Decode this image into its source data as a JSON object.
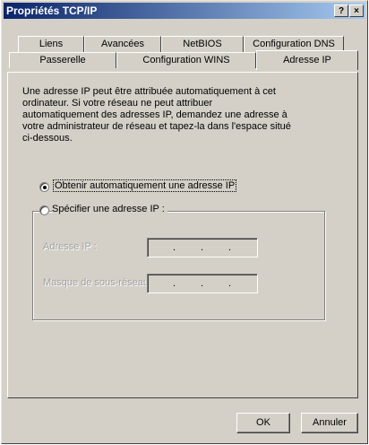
{
  "window": {
    "title": "Propriétés TCP/IP",
    "help_button": "?",
    "close_button": "×"
  },
  "tabs": {
    "row1": [
      "Liens",
      "Avancées",
      "NetBIOS",
      "Configuration DNS"
    ],
    "row2": [
      "Passerelle",
      "Configuration WINS",
      "Adresse IP"
    ],
    "active": "Adresse IP"
  },
  "description": "Une adresse IP peut être attribuée automatiquement à cet ordinateur. Si votre réseau ne peut attribuer automatiquement des adresses IP, demandez une adresse à votre administrateur de réseau et tapez-la dans l'espace situé ci-dessous.",
  "options": {
    "auto": {
      "label": "Obtenir automatiquement une adresse IP",
      "selected": true
    },
    "manual": {
      "label": "Spécifier une adresse IP :",
      "selected": false
    }
  },
  "fields": {
    "ip_label": "Adresse IP :",
    "mask_label": "Masque de sous-réseau :",
    "separator": "."
  },
  "buttons": {
    "ok": "OK",
    "cancel": "Annuler"
  }
}
